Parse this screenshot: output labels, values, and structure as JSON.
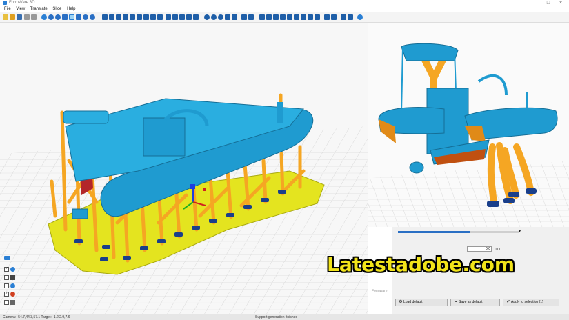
{
  "window": {
    "title": "FormWare 3D"
  },
  "menu": [
    "File",
    "View",
    "Translate",
    "Slice",
    "Help"
  ],
  "panel": {
    "value": "0.0",
    "unit": "mm",
    "load_default": "Load default",
    "save_as_default": "Save as default",
    "apply_to_selection": "Apply to selection (1)",
    "footer_label": "Formware"
  },
  "status": {
    "left": "Camera: -54.7,44.3,57.1 Target: -1.2,2.9,7.6",
    "center": "Support generation finished"
  },
  "watermark": "Latestadobe.com",
  "colors": {
    "hull": "#1f9bd0",
    "support": "#f5a623",
    "base_plate": "#e4e41f",
    "overhang": "#b3262a",
    "foot": "#1a3f8a",
    "accent": "#2a7fd4"
  }
}
